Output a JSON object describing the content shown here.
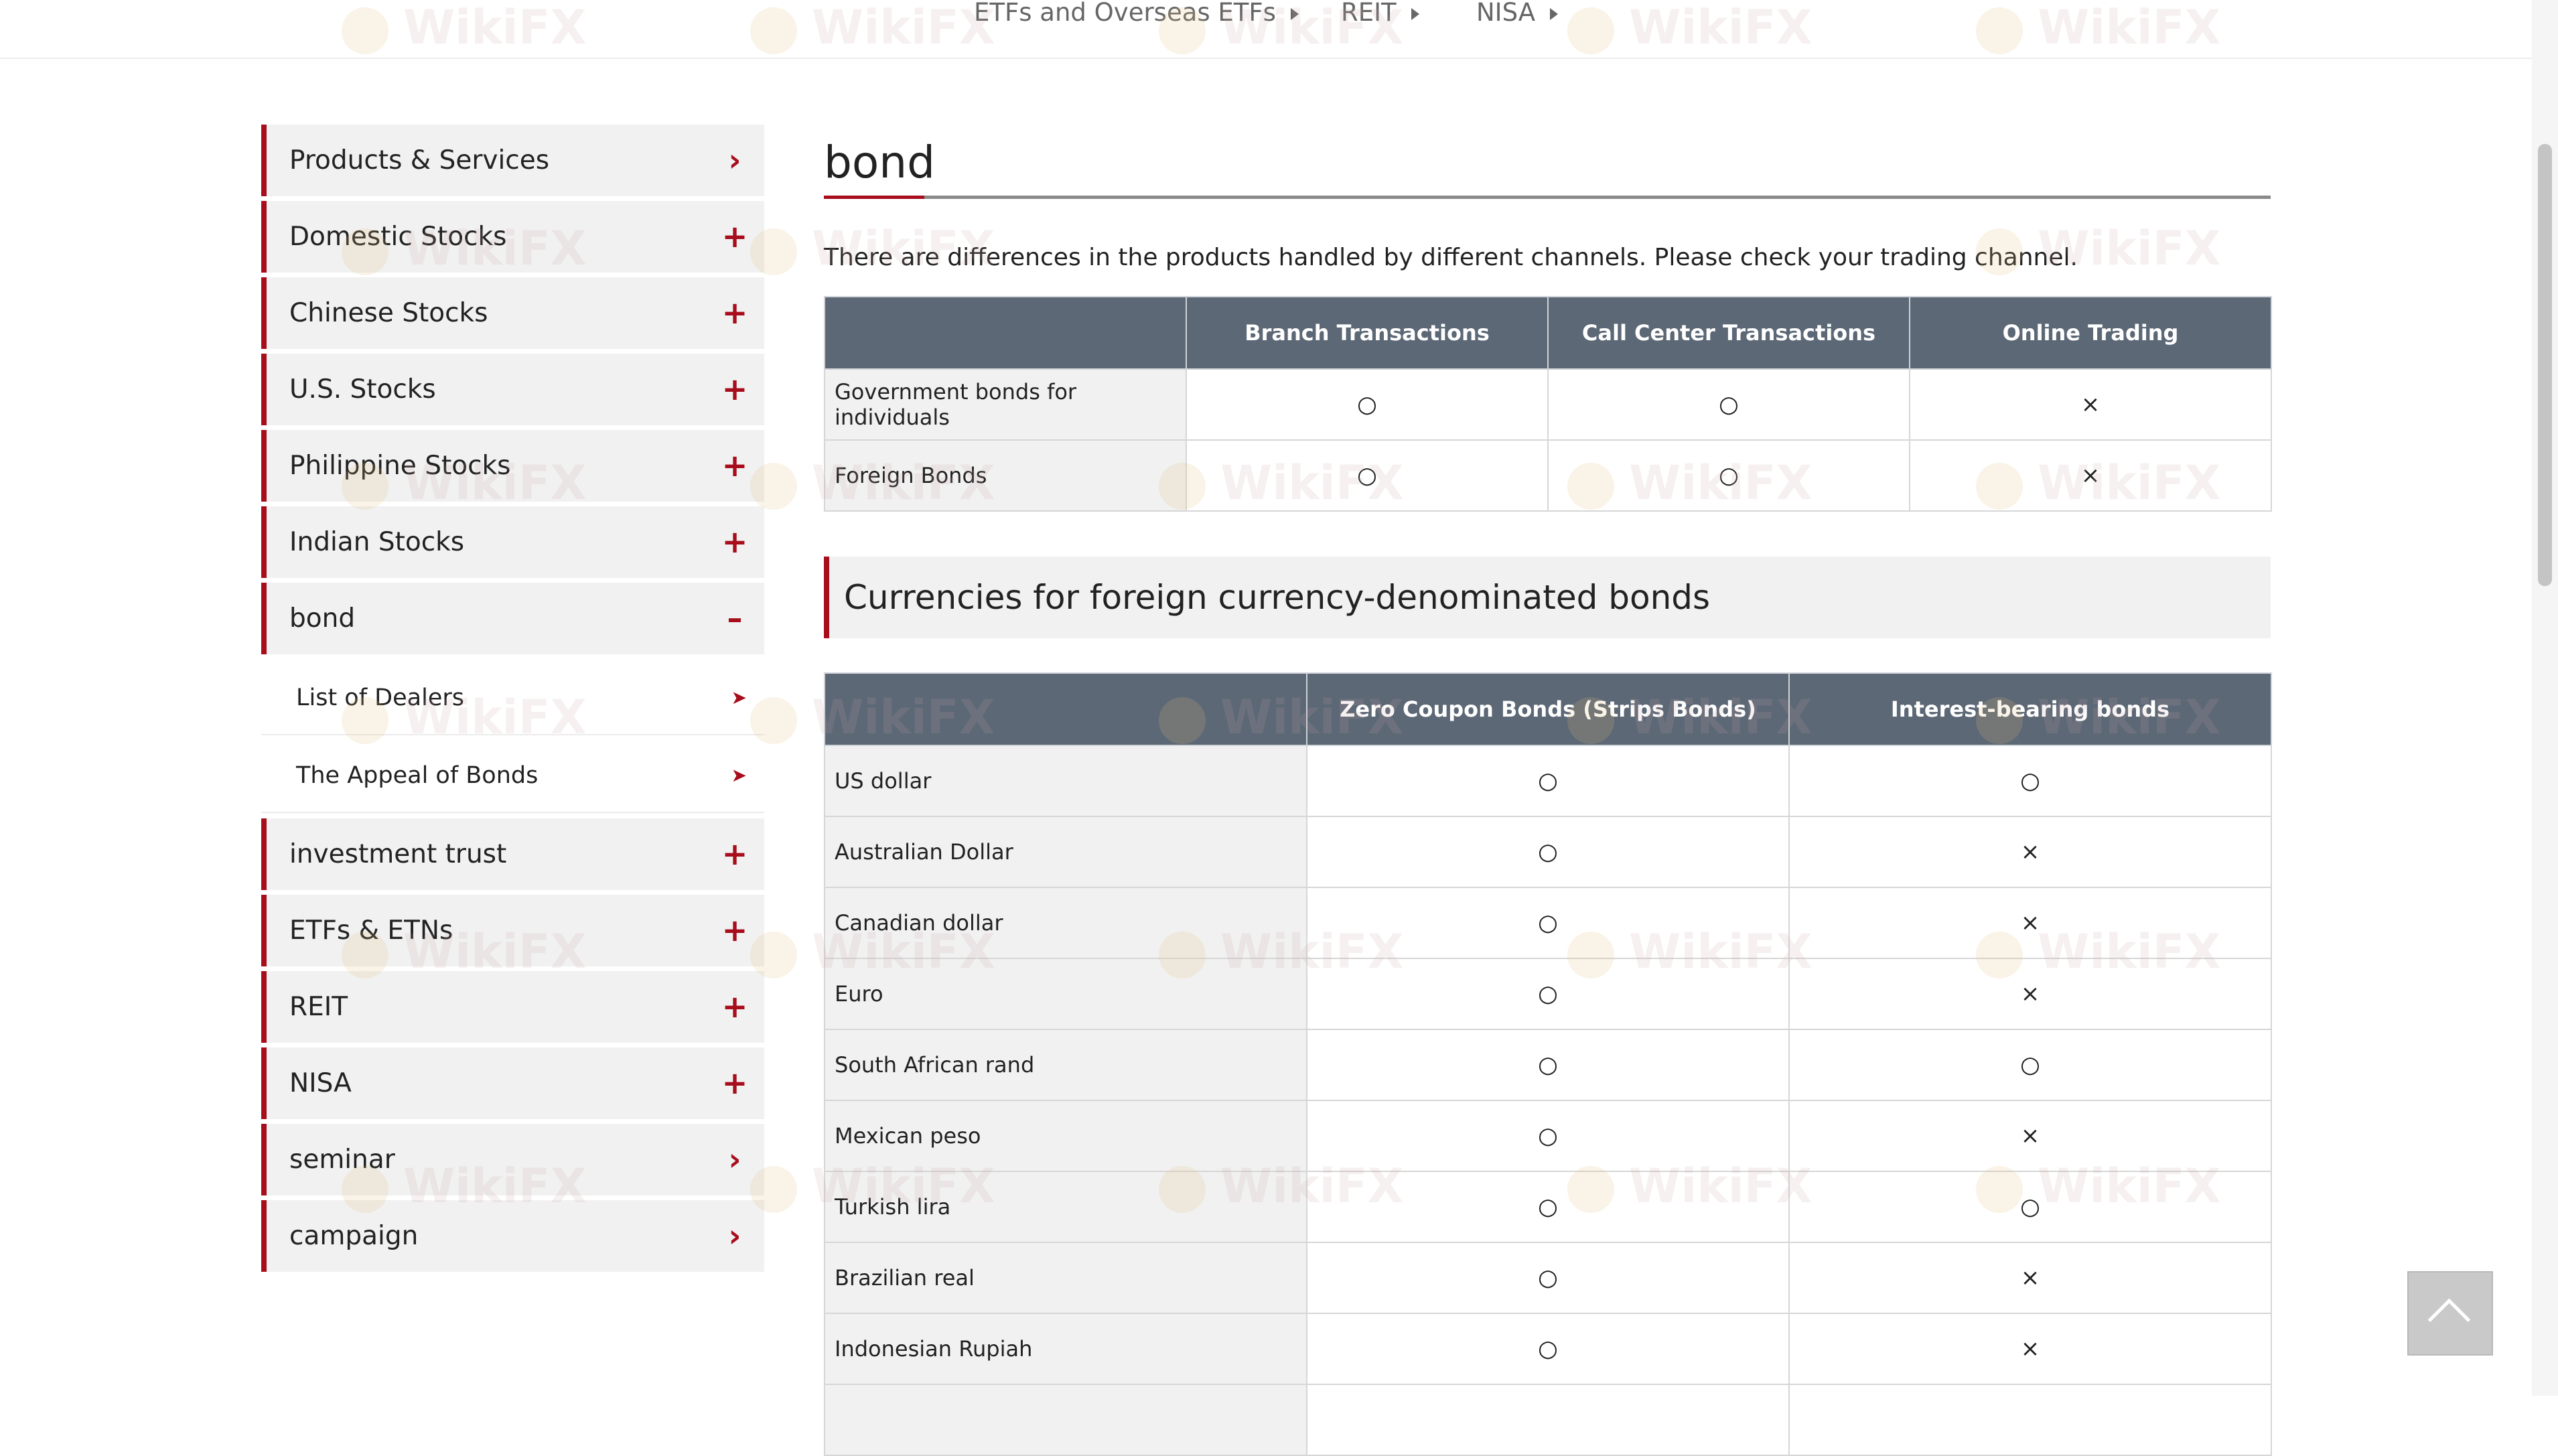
{
  "breadcrumb": {
    "items": [
      "ETFs and Overseas ETFs",
      "REIT",
      "NISA"
    ]
  },
  "sidebar": {
    "items": [
      {
        "label": "Products & Services",
        "icon": "chevron-right-icon"
      },
      {
        "label": "Domestic Stocks",
        "icon": "plus-icon"
      },
      {
        "label": "Chinese Stocks",
        "icon": "plus-icon"
      },
      {
        "label": "U.S. Stocks",
        "icon": "plus-icon"
      },
      {
        "label": "Philippine Stocks",
        "icon": "plus-icon"
      },
      {
        "label": "Indian Stocks",
        "icon": "plus-icon"
      },
      {
        "label": "bond",
        "icon": "minus-icon"
      },
      {
        "label": "investment trust",
        "icon": "plus-icon"
      },
      {
        "label": "ETFs & ETNs",
        "icon": "plus-icon"
      },
      {
        "label": "REIT",
        "icon": "plus-icon"
      },
      {
        "label": "NISA",
        "icon": "plus-icon"
      },
      {
        "label": "seminar",
        "icon": "chevron-right-icon"
      },
      {
        "label": "campaign",
        "icon": "chevron-right-icon"
      }
    ],
    "bond_subitems": [
      {
        "label": "List of Dealers",
        "icon": "arrow-right-icon"
      },
      {
        "label": "The Appeal of Bonds",
        "icon": "arrow-right-icon"
      }
    ]
  },
  "main": {
    "title": "bond",
    "intro": "There are differences in the products handled by different channels. Please check your trading channel.",
    "channels_table": {
      "headers": [
        "",
        "Branch Transactions",
        "Call Center Transactions",
        "Online Trading"
      ],
      "rows": [
        {
          "label": "Government bonds for individuals",
          "values": [
            "○",
            "○",
            "×"
          ]
        },
        {
          "label": "Foreign Bonds",
          "values": [
            "○",
            "○",
            "×"
          ]
        }
      ]
    },
    "section_heading": "Currencies for foreign currency-denominated bonds",
    "currency_table": {
      "headers": [
        "",
        "Zero Coupon Bonds (Strips Bonds)",
        "Interest-bearing bonds"
      ],
      "rows": [
        {
          "label": "US dollar",
          "values": [
            "○",
            "○"
          ]
        },
        {
          "label": "Australian Dollar",
          "values": [
            "○",
            "×"
          ]
        },
        {
          "label": "Canadian dollar",
          "values": [
            "○",
            "×"
          ]
        },
        {
          "label": "Euro",
          "values": [
            "○",
            "×"
          ]
        },
        {
          "label": "South African rand",
          "values": [
            "○",
            "○"
          ]
        },
        {
          "label": "Mexican peso",
          "values": [
            "○",
            "×"
          ]
        },
        {
          "label": "Turkish lira",
          "values": [
            "○",
            "○"
          ]
        },
        {
          "label": "Brazilian real",
          "values": [
            "○",
            "×"
          ]
        },
        {
          "label": "Indonesian Rupiah",
          "values": [
            "○",
            "×"
          ]
        },
        {
          "label": "",
          "values": [
            "",
            ""
          ]
        }
      ]
    }
  },
  "watermark": "WikiFX",
  "colors": {
    "accent": "#a80d1c",
    "table_header": "#5c6876",
    "row_header_bg": "#f1f1f1"
  }
}
